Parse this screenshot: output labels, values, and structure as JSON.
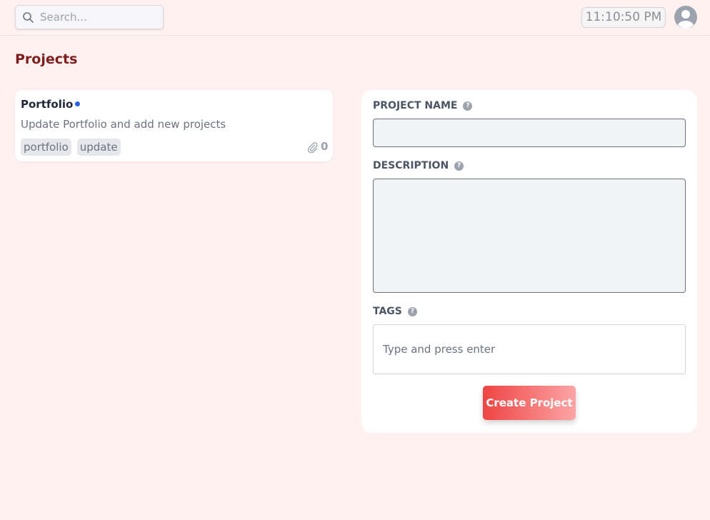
{
  "header": {
    "search_placeholder": "Search...",
    "clock": "11:10:50 PM",
    "avatar_icon": "user-circle-icon"
  },
  "page": {
    "title": "Projects"
  },
  "projects": [
    {
      "title": "Portfolio",
      "status_color": "#2563eb",
      "description": "Update Portfolio and add new projects",
      "tags": [
        "portfolio",
        "update"
      ],
      "attachments": "0",
      "attachment_icon": "paperclip-icon"
    }
  ],
  "form": {
    "project_name_label": "PROJECT NAME",
    "project_name_value": "",
    "description_label": "DESCRIPTION",
    "description_value": "",
    "tags_label": "TAGS",
    "tags_placeholder": "Type and press enter",
    "help_icon": "question-circle-icon",
    "submit_label": "Create Project"
  },
  "colors": {
    "background": "#fff1f0",
    "title": "#7f1d1d",
    "button_start": "#ef4444",
    "button_end": "#fca5a5"
  }
}
